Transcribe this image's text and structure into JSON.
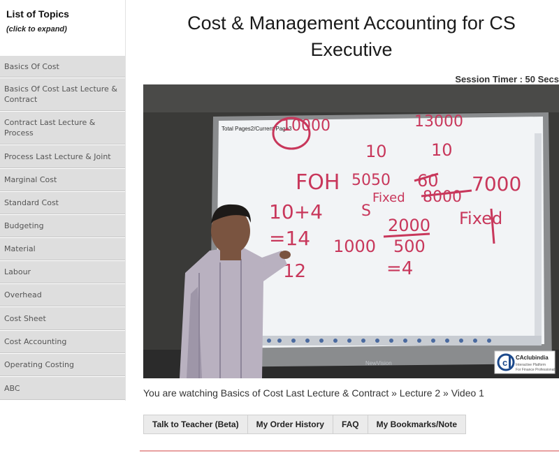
{
  "sidebar": {
    "title": "List of Topics",
    "subtitle": "(click to expand)",
    "topics": [
      "Basics Of Cost",
      "Basics Of Cost Last Lecture & Contract",
      "Contract Last Lecture & Process",
      "Process Last Lecture & Joint",
      "Marginal Cost",
      "Standard Cost",
      "Budgeting",
      "Material",
      "Labour",
      "Overhead",
      "Cost Sheet",
      "Cost Accounting",
      "Operating Costing",
      "ABC"
    ]
  },
  "main": {
    "title": "Cost & Management Accounting for CS Executive",
    "session_timer": "Session Timer : 50 Secs",
    "now_watching": "You are watching Basics of Cost Last Lecture & Contract » Lecture 2 » Video 1"
  },
  "video": {
    "board_header": "Total Pages2/Current Page3",
    "board_brand": "NewVision",
    "watermark": {
      "name": "CAclubindia",
      "tagline_1": "Interactive Platform",
      "tagline_2": "For Finance Professionals"
    },
    "handwriting": {
      "top_left": "10000",
      "top_right": "13000",
      "ten_a": "10",
      "ten_b": "10",
      "foh": "FOH",
      "v5050": "5050",
      "fixed_1": "Fixed",
      "v60": "60",
      "v7000": "7000",
      "v8000": "8000",
      "s": "S",
      "ten_four": "10+4",
      "eq14": "=14",
      "v12": "12",
      "v1000": "1000",
      "frac_num": "2000",
      "frac_den": "500",
      "eq4": "=4",
      "fixed_2": "Fixed"
    }
  },
  "actions": {
    "talk": "Talk to Teacher (Beta)",
    "orders": "My Order History",
    "faq": "FAQ",
    "bookmarks": "My Bookmarks/Note"
  },
  "colors": {
    "ink": "#c8375b",
    "sidebar_item_bg": "#dedede",
    "accent_rule": "#e8a0a0"
  }
}
